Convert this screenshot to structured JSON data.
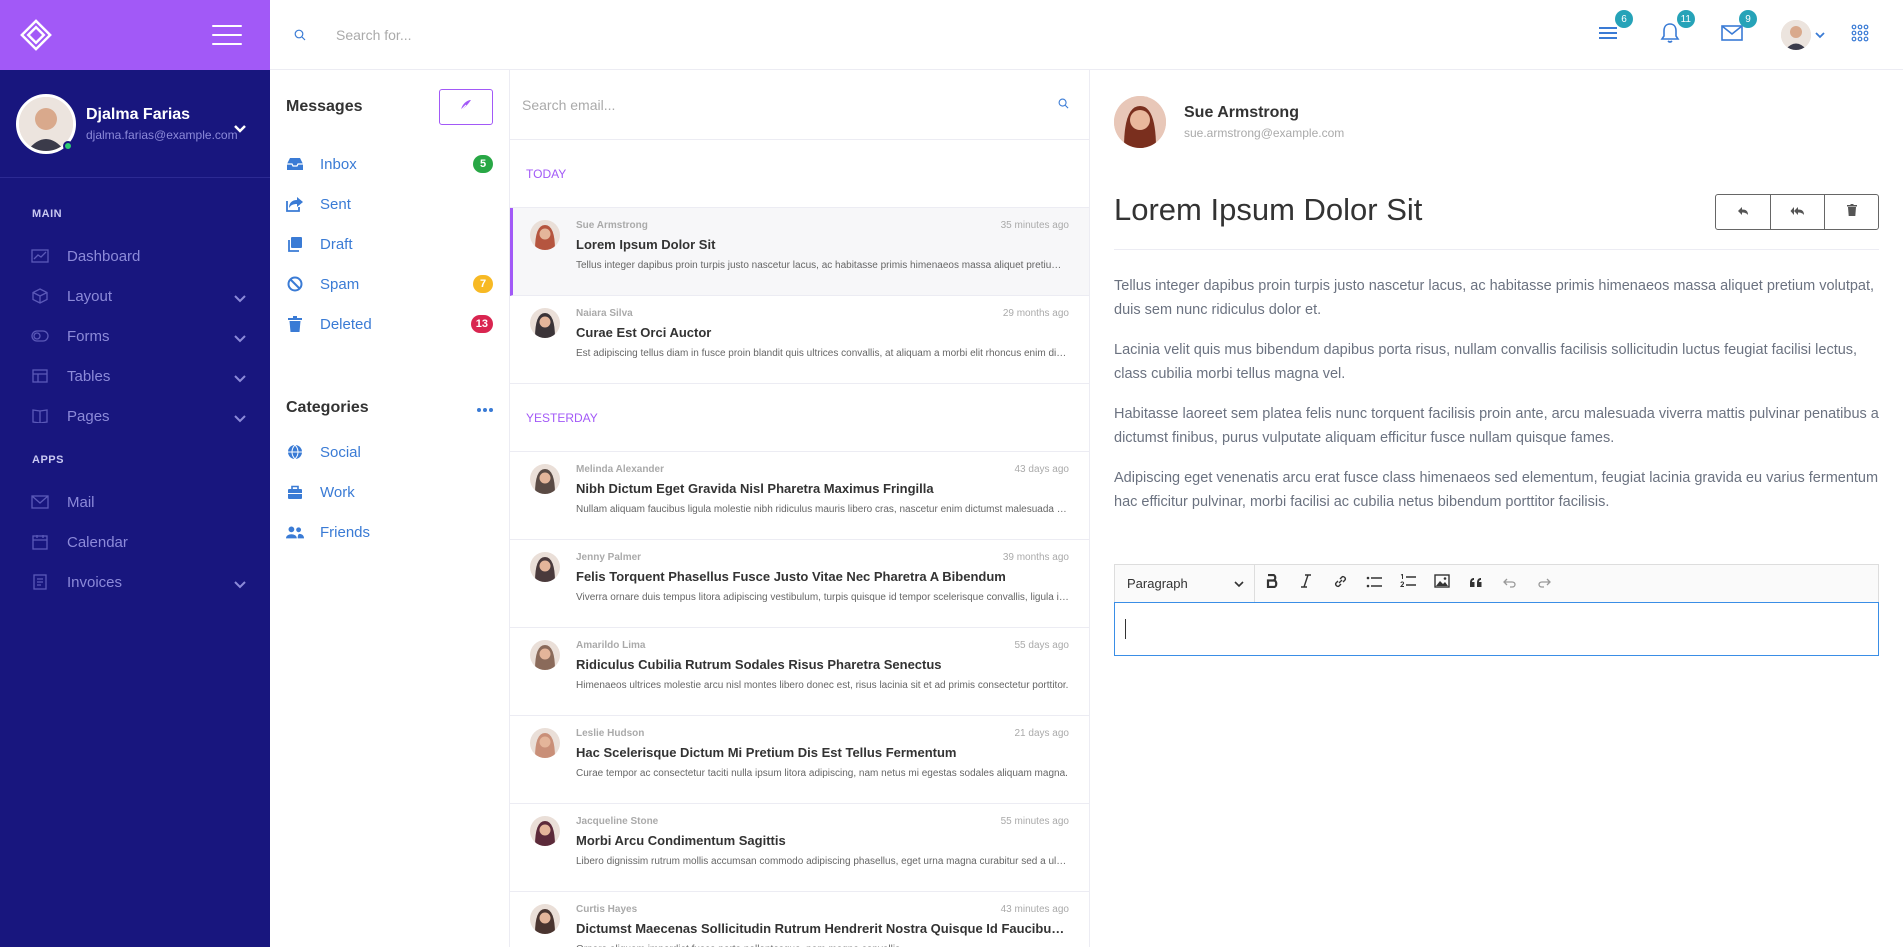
{
  "sidebar": {
    "user": {
      "name": "Djalma Farias",
      "email": "djalma.farias@example.com"
    },
    "sections": [
      {
        "label": "MAIN",
        "items": [
          {
            "label": "Dashboard",
            "icon": "dashboard-icon",
            "has_children": false
          },
          {
            "label": "Layout",
            "icon": "cube-icon",
            "has_children": true
          },
          {
            "label": "Forms",
            "icon": "toggle-icon",
            "has_children": true
          },
          {
            "label": "Tables",
            "icon": "table-icon",
            "has_children": true
          },
          {
            "label": "Pages",
            "icon": "book-icon",
            "has_children": true
          }
        ]
      },
      {
        "label": "APPS",
        "items": [
          {
            "label": "Mail",
            "icon": "mail-icon",
            "has_children": false
          },
          {
            "label": "Calendar",
            "icon": "calendar-icon",
            "has_children": false
          },
          {
            "label": "Invoices",
            "icon": "invoice-icon",
            "has_children": true
          }
        ]
      }
    ]
  },
  "topbar": {
    "search_placeholder": "Search for...",
    "badges": {
      "tasks": "6",
      "notifications": "11",
      "messages": "9"
    }
  },
  "mailnav": {
    "title": "Messages",
    "folders": [
      {
        "label": "Inbox",
        "icon": "inbox-icon",
        "badge": "5",
        "badge_color": "#28a745"
      },
      {
        "label": "Sent",
        "icon": "share-icon",
        "badge": "",
        "badge_color": ""
      },
      {
        "label": "Draft",
        "icon": "copy-icon",
        "badge": "",
        "badge_color": ""
      },
      {
        "label": "Spam",
        "icon": "ban-icon",
        "badge": "7",
        "badge_color": "#f7b924"
      },
      {
        "label": "Deleted",
        "icon": "trash-icon",
        "badge": "13",
        "badge_color": "#d92550"
      }
    ],
    "categories_title": "Categories",
    "categories": [
      {
        "label": "Social",
        "icon": "globe-icon"
      },
      {
        "label": "Work",
        "icon": "briefcase-icon"
      },
      {
        "label": "Friends",
        "icon": "users-icon"
      }
    ]
  },
  "maillist": {
    "search_placeholder": "Search email...",
    "groups": [
      {
        "label": "TODAY",
        "items": [
          {
            "sender": "Sue Armstrong",
            "time": "35 minutes ago",
            "subject": "Lorem Ipsum Dolor Sit",
            "preview": "Tellus integer dapibus proin turpis justo nascetur lacus, ac habitasse primis himenaeos massa aliquet pretium volutpat, duis sem nunc ridiculus dolor et.",
            "active": true,
            "avatar_color": "#b5553f"
          },
          {
            "sender": "Naiara Silva",
            "time": "29 months ago",
            "subject": "Curae Est Orci Auctor",
            "preview": "Est adipiscing tellus diam in fusce proin blandit quis ultrices convallis, at aliquam a morbi elit rhoncus enim dignissim.",
            "active": false,
            "avatar_color": "#3b3438"
          }
        ]
      },
      {
        "label": "YESTERDAY",
        "items": [
          {
            "sender": "Melinda Alexander",
            "time": "43 days ago",
            "subject": "Nibh Dictum Eget Gravida Nisl Pharetra Maximus Fringilla",
            "preview": "Nullam aliquam faucibus ligula molestie nibh ridiculus mauris libero cras, nascetur enim dictumst malesuada viverra.",
            "active": false,
            "avatar_color": "#5a4a44"
          },
          {
            "sender": "Jenny Palmer",
            "time": "39 months ago",
            "subject": "Felis Torquent Phasellus Fusce Justo Vitae Nec Pharetra A Bibendum",
            "preview": "Viverra ornare duis tempus litora adipiscing vestibulum, turpis quisque id tempor scelerisque convallis, ligula integer.",
            "active": false,
            "avatar_color": "#4a3a3c"
          },
          {
            "sender": "Amarildo Lima",
            "time": "55 days ago",
            "subject": "Ridiculus Cubilia Rutrum Sodales Risus Pharetra Senectus",
            "preview": "Himenaeos ultrices molestie arcu nisl montes libero donec est, risus lacinia sit et ad primis consectetur porttitor.",
            "active": false,
            "avatar_color": "#8a6a5a"
          },
          {
            "sender": "Leslie Hudson",
            "time": "21 days ago",
            "subject": "Hac Scelerisque Dictum Mi Pretium Dis Est Tellus Fermentum",
            "preview": "Curae tempor ac consectetur taciti nulla ipsum litora adipiscing, nam netus mi egestas sodales aliquam magna.",
            "active": false,
            "avatar_color": "#c98f78"
          },
          {
            "sender": "Jacqueline Stone",
            "time": "55 minutes ago",
            "subject": "Morbi Arcu Condimentum Sagittis",
            "preview": "Libero dignissim rutrum mollis accumsan commodo adipiscing phasellus, eget urna magna curabitur sed a ultrices.",
            "active": false,
            "avatar_color": "#5c2a3a"
          },
          {
            "sender": "Curtis Hayes",
            "time": "43 minutes ago",
            "subject": "Dictumst Maecenas Sollicitudin Rutrum Hendrerit Nostra Quisque Id Faucibus Cursus",
            "preview": "Ornare aliquam imperdiet fusce porta pellentesque, nam magna convallis.",
            "active": false,
            "avatar_color": "#4a3530"
          }
        ]
      }
    ]
  },
  "reader": {
    "from_name": "Sue Armstrong",
    "from_email": "sue.armstrong@example.com",
    "subject": "Lorem Ipsum Dolor Sit",
    "paragraphs": [
      "Tellus integer dapibus proin turpis justo nascetur lacus, ac habitasse primis himenaeos massa aliquet pretium volutpat, duis sem nunc ridiculus dolor et.",
      "Lacinia velit quis mus bibendum dapibus porta risus, nullam convallis facilisis sollicitudin luctus feugiat facilisi lectus, class cubilia morbi tellus magna vel.",
      "Habitasse laoreet sem platea felis nunc torquent facilisis proin ante, arcu malesuada viverra mattis pulvinar penatibus a dictumst finibus, purus vulputate aliquam efficitur fusce nullam quisque fames.",
      "Adipiscing eget venenatis arcu erat fusce class himenaeos sed elementum, feugiat lacinia gravida eu varius fermentum hac efficitur pulvinar, morbi facilisi ac cubilia netus bibendum porttitor facilisis."
    ],
    "editor_block_format": "Paragraph"
  },
  "colors": {
    "sidebar": "#18167e",
    "accent": "#a259f7",
    "link": "#3a7bd5",
    "badge": "#26a3b8"
  }
}
